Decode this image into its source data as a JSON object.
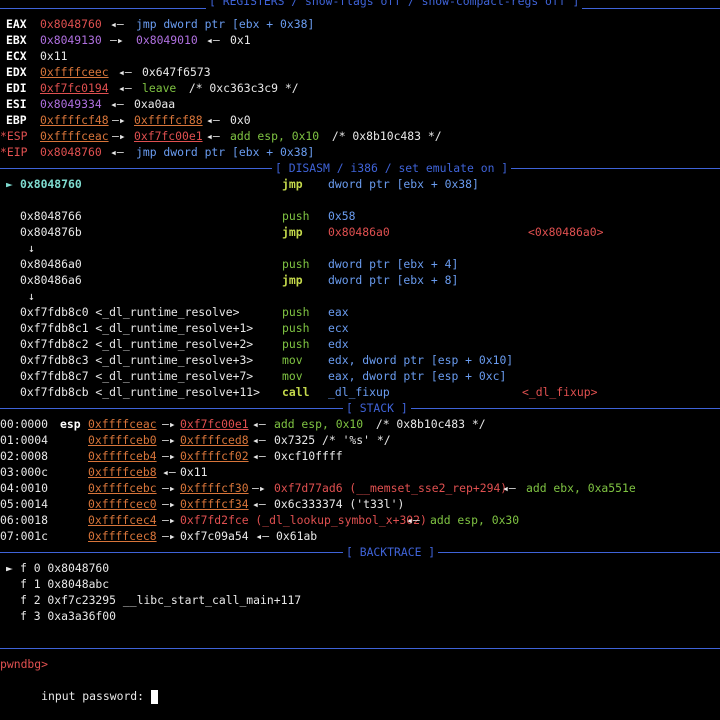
{
  "headers": {
    "registers": "[ REGISTERS / show-flags off / show-compact-regs off ]",
    "disasm": "[ DISASM / i386 / set emulate on ]",
    "stack": "[ STACK ]",
    "backtrace": "[ BACKTRACE ]"
  },
  "registers": {
    "eax": {
      "name": "EAX",
      "v1": "0x8048760",
      "arrow": "◂—",
      "rest": "jmp dword ptr [ebx + 0x38]"
    },
    "ebx": {
      "name": "EBX",
      "v1": "0x8049130",
      "a1": "—▸",
      "v2": "0x8049010",
      "a2": "◂—",
      "rest": "0x1"
    },
    "ecx": {
      "name": "ECX",
      "v1": "0x11"
    },
    "edx": {
      "name": "EDX",
      "v1": "0xffffceec",
      "a1": "◂—",
      "rest": "0x647f6573"
    },
    "edi": {
      "name": "EDI",
      "v1": "0xf7fc0194",
      "a1": "◂—",
      "ins": "leave",
      "comment": " /* 0xc363c3c9 */"
    },
    "esi": {
      "name": "ESI",
      "v1": "0x8049334",
      "a1": "◂—",
      "rest": "0xa0aa"
    },
    "ebp": {
      "name": "EBP",
      "v1": "0xffffcf48",
      "a1": "—▸",
      "v2": "0xffffcf88",
      "a2": "◂—",
      "rest": "0x0"
    },
    "esp": {
      "name": "*ESP",
      "v1": "0xffffceac",
      "a1": "—▸",
      "v2": "0xf7fc00e1",
      "a2": "◂—",
      "ins": "add esp, 0x10",
      "comment": " /* 0x8b10c483 */"
    },
    "eip": {
      "name": "*EIP",
      "v1": "0x8048760",
      "a1": "◂—",
      "rest": "jmp dword ptr [ebx + 0x38]"
    }
  },
  "disasm": [
    {
      "marker": "►",
      "addr": "0x8048760",
      "mn": "jmp",
      "op": "dword ptr [ebx + 0x38]",
      "target": ""
    },
    {
      "addr": "",
      "mn": "",
      "op": "",
      "target": ""
    },
    {
      "addr": "0x8048766",
      "mn": "push",
      "op": "0x58",
      "target": ""
    },
    {
      "addr": "0x804876b",
      "mn": "jmp",
      "op": "0x80486a0",
      "target": "<0x80486a0>"
    },
    {
      "arrow": "↓"
    },
    {
      "addr": "0x80486a0",
      "mn": "push",
      "op": "dword ptr [ebx + 4]",
      "target": ""
    },
    {
      "addr": "0x80486a6",
      "mn": "jmp",
      "op": "dword ptr [ebx + 8]",
      "target": ""
    },
    {
      "arrow": "↓"
    },
    {
      "addr": "0xf7fdb8c0 <_dl_runtime_resolve>",
      "mn": "push",
      "op": "eax",
      "target": ""
    },
    {
      "addr": "0xf7fdb8c1 <_dl_runtime_resolve+1>",
      "mn": "push",
      "op": "ecx",
      "target": ""
    },
    {
      "addr": "0xf7fdb8c2 <_dl_runtime_resolve+2>",
      "mn": "push",
      "op": "edx",
      "target": ""
    },
    {
      "addr": "0xf7fdb8c3 <_dl_runtime_resolve+3>",
      "mn": "mov",
      "op": "edx, dword ptr [esp + 0x10]",
      "target": ""
    },
    {
      "addr": "0xf7fdb8c7 <_dl_runtime_resolve+7>",
      "mn": "mov",
      "op": "eax, dword ptr [esp + 0xc]",
      "target": ""
    },
    {
      "addr": "0xf7fdb8cb <_dl_runtime_resolve+11>",
      "mn": "call",
      "op": "_dl_fixup",
      "target": "<_dl_fixup>"
    }
  ],
  "stack": [
    {
      "idx": "00:0000",
      "reg": "esp",
      "a": "0xffffceac",
      "a1": "—▸",
      "b": "0xf7fc00e1",
      "a2": "◂—",
      "ins": "add esp, 0x10",
      "comment": " /* 0x8b10c483 */"
    },
    {
      "idx": "01:0004",
      "reg": "",
      "a": "0xffffceb0",
      "a1": "—▸",
      "b": "0xffffced8",
      "a2": "◂—",
      "rest": "0x7325 /* '%s' */"
    },
    {
      "idx": "02:0008",
      "reg": "",
      "a": "0xffffceb4",
      "a1": "—▸",
      "b": "0xffffcf02",
      "a2": "◂—",
      "rest": "0xcf10ffff"
    },
    {
      "idx": "03:000c",
      "reg": "",
      "a": "0xffffceb8",
      "a1": "◂—",
      "rest": "0x11"
    },
    {
      "idx": "04:0010",
      "reg": "",
      "a": "0xffffcebc",
      "a1": "—▸",
      "b": "0xffffcf30",
      "a2": "—▸",
      "c": "0xf7d77ad6 (__memset_sse2_rep+294)",
      "a3": "◂—",
      "ins": "add ebx, 0xa551e"
    },
    {
      "idx": "05:0014",
      "reg": "",
      "a": "0xffffcec0",
      "a1": "—▸",
      "b": "0xffffcf34",
      "a2": "◂—",
      "rest": "0x6c333374 ('t33l')"
    },
    {
      "idx": "06:0018",
      "reg": "",
      "a": "0xffffcec4",
      "a1": "—▸",
      "c": "0xf7fd2fce (_dl_lookup_symbol_x+302)",
      "a2": "◂—",
      "ins": "add esp, 0x30"
    },
    {
      "idx": "07:001c",
      "reg": "",
      "a": "0xffffcec8",
      "a1": "—▸",
      "rest": "0xf7c09a54 ◂— 0x61ab"
    }
  ],
  "backtrace": [
    {
      "marker": "►",
      "text": "f 0 0x8048760"
    },
    {
      "marker": "",
      "text": "f 1 0x8048abc"
    },
    {
      "marker": "",
      "text": "f 2 0xf7c23295 __libc_start_call_main+117"
    },
    {
      "marker": "",
      "text": "f 3 0xa3a36f00"
    }
  ],
  "prompt": "pwndbg>",
  "input_line": "input password: "
}
